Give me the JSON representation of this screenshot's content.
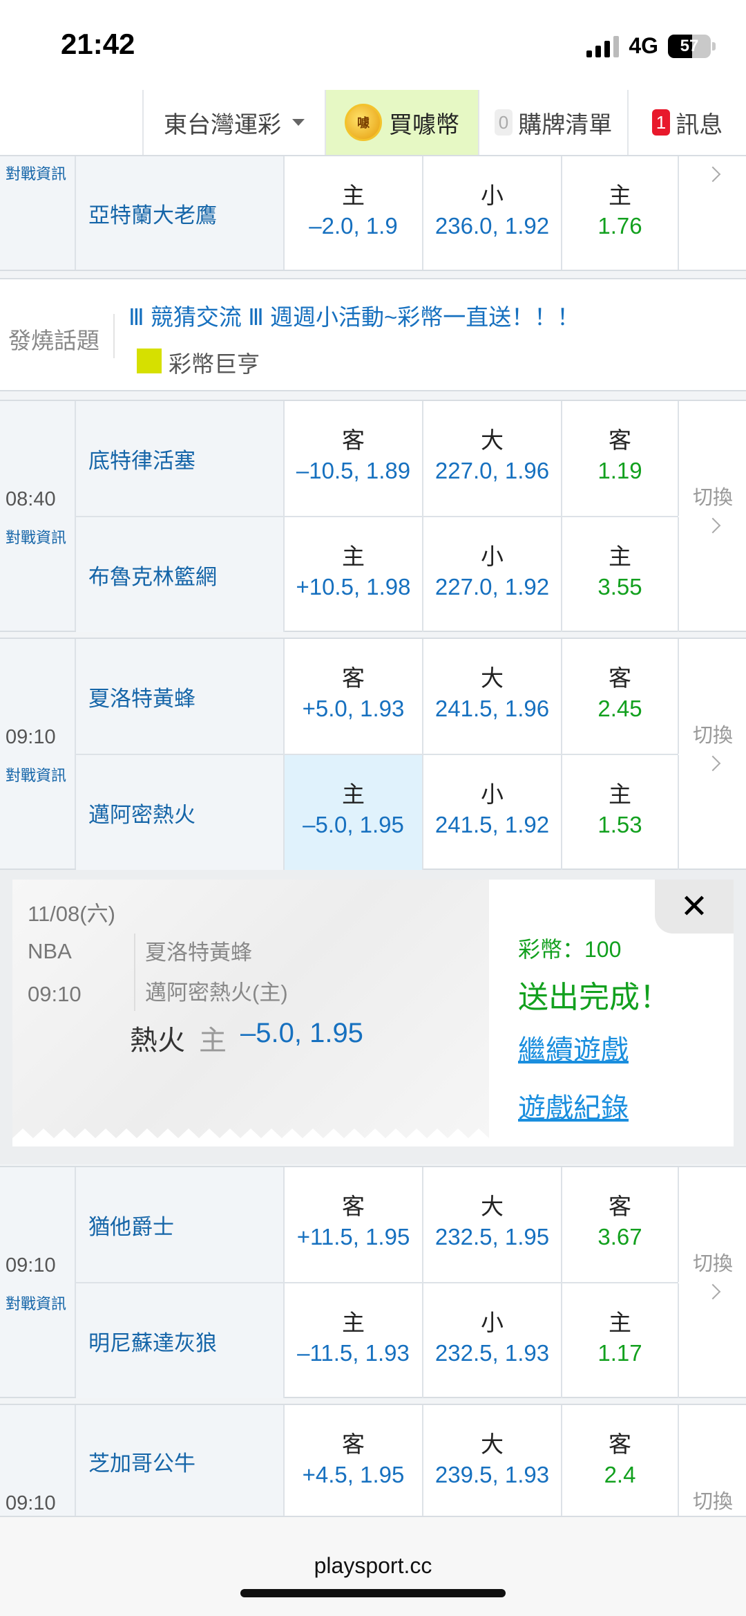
{
  "status": {
    "time": "21:42",
    "network": "4G",
    "battery": "57"
  },
  "nav": {
    "region": "東台灣運彩",
    "buy": "買噱幣",
    "coin_icon_text": "噱",
    "cart_count": "0",
    "cart": "購牌清單",
    "msg_count": "1",
    "msg": "訊息"
  },
  "common": {
    "info": "對戰資訊",
    "switch": "切換"
  },
  "game0": {
    "away": {
      "team": "亞特蘭大老鷹",
      "s_lbl": "主",
      "s_val": "–2.0, 1.9",
      "t_lbl": "小",
      "t_val": "236.0, 1.92",
      "m_lbl": "主",
      "m_val": "1.76"
    }
  },
  "topic": {
    "label": "發燒話題",
    "title": "Ⅲ 競猜交流 Ⅲ 週週小活動~彩幣一直送！！！",
    "user": "彩幣巨亨"
  },
  "games": [
    {
      "time": "08:40",
      "rows": [
        {
          "team": "底特律活塞",
          "s_lbl": "客",
          "s_val": "–10.5, 1.89",
          "t_lbl": "大",
          "t_val": "227.0, 1.96",
          "m_lbl": "客",
          "m_val": "1.19"
        },
        {
          "team": "布魯克林籃網",
          "s_lbl": "主",
          "s_val": "+10.5, 1.98",
          "t_lbl": "小",
          "t_val": "227.0, 1.92",
          "m_lbl": "主",
          "m_val": "3.55"
        }
      ]
    },
    {
      "time": "09:10",
      "rows": [
        {
          "team": "夏洛特黃蜂",
          "s_lbl": "客",
          "s_val": "+5.0, 1.93",
          "t_lbl": "大",
          "t_val": "241.5, 1.96",
          "m_lbl": "客",
          "m_val": "2.45"
        },
        {
          "team": "邁阿密熱火",
          "s_lbl": "主",
          "s_val": "–5.0, 1.95",
          "t_lbl": "小",
          "t_val": "241.5, 1.92",
          "m_lbl": "主",
          "m_val": "1.53"
        }
      ]
    },
    {
      "time": "09:10",
      "rows": [
        {
          "team": "猶他爵士",
          "s_lbl": "客",
          "s_val": "+11.5, 1.95",
          "t_lbl": "大",
          "t_val": "232.5, 1.95",
          "m_lbl": "客",
          "m_val": "3.67"
        },
        {
          "team": "明尼蘇達灰狼",
          "s_lbl": "主",
          "s_val": "–11.5, 1.93",
          "t_lbl": "小",
          "t_val": "232.5, 1.93",
          "m_lbl": "主",
          "m_val": "1.17"
        }
      ]
    },
    {
      "time": "09:10",
      "rows": [
        {
          "team": "芝加哥公牛",
          "s_lbl": "客",
          "s_val": "+4.5, 1.95",
          "t_lbl": "大",
          "t_val": "239.5, 1.93",
          "m_lbl": "客",
          "m_val": "2.4"
        }
      ]
    }
  ],
  "confirm": {
    "date": "11/08(六)",
    "league": "NBA",
    "time": "09:10",
    "team1": "夏洛特黃蜂",
    "team2": "邁阿密熱火(主)",
    "pick_team": "熱火",
    "pick_side": "主",
    "pick_odds": "–5.0, 1.95",
    "coins": "彩幣：100",
    "done": "送出完成！",
    "continue": "繼續遊戲",
    "history": "遊戲紀錄",
    "close": "✕"
  },
  "footer": {
    "url": "playsport.cc"
  }
}
